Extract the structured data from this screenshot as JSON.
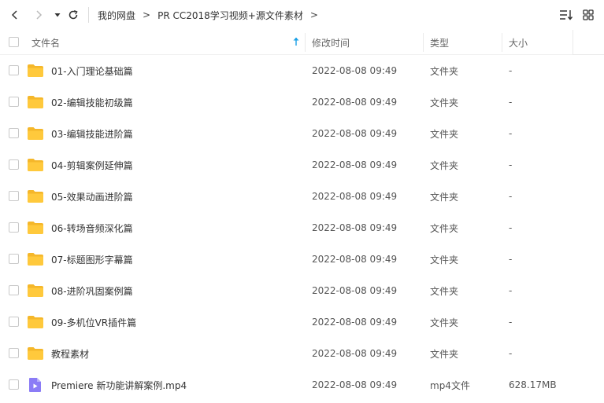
{
  "breadcrumb": [
    {
      "label": "我的网盘"
    },
    {
      "label": "PR CC2018学习视频+源文件素材"
    }
  ],
  "breadcrumb_sep": ">",
  "columns": {
    "name": "文件名",
    "modified": "修改时间",
    "type": "类型",
    "size": "大小"
  },
  "files": [
    {
      "name": "01-入门理论基础篇",
      "modified": "2022-08-08 09:49",
      "type": "文件夹",
      "size": "-",
      "icon": "folder-icon"
    },
    {
      "name": "02-编辑技能初级篇",
      "modified": "2022-08-08 09:49",
      "type": "文件夹",
      "size": "-",
      "icon": "folder-icon"
    },
    {
      "name": "03-编辑技能进阶篇",
      "modified": "2022-08-08 09:49",
      "type": "文件夹",
      "size": "-",
      "icon": "folder-icon"
    },
    {
      "name": "04-剪辑案例延伸篇",
      "modified": "2022-08-08 09:49",
      "type": "文件夹",
      "size": "-",
      "icon": "folder-icon"
    },
    {
      "name": "05-效果动画进阶篇",
      "modified": "2022-08-08 09:49",
      "type": "文件夹",
      "size": "-",
      "icon": "folder-icon"
    },
    {
      "name": "06-转场音频深化篇",
      "modified": "2022-08-08 09:49",
      "type": "文件夹",
      "size": "-",
      "icon": "folder-icon"
    },
    {
      "name": "07-标题图形字幕篇",
      "modified": "2022-08-08 09:49",
      "type": "文件夹",
      "size": "-",
      "icon": "folder-icon"
    },
    {
      "name": "08-进阶巩固案例篇",
      "modified": "2022-08-08 09:49",
      "type": "文件夹",
      "size": "-",
      "icon": "folder-icon"
    },
    {
      "name": "09-多机位VR插件篇",
      "modified": "2022-08-08 09:49",
      "type": "文件夹",
      "size": "-",
      "icon": "folder-icon"
    },
    {
      "name": "教程素材",
      "modified": "2022-08-08 09:49",
      "type": "文件夹",
      "size": "-",
      "icon": "folder-icon"
    },
    {
      "name": "Premiere  新功能讲解案例.mp4",
      "modified": "2022-08-08 09:49",
      "type": "mp4文件",
      "size": "628.17MB",
      "icon": "video-file-icon"
    }
  ],
  "colors": {
    "folder": "#ffc93c",
    "folder_tab": "#f5b72a",
    "video_file": "#8b7cf6",
    "sort_arrow": "#1aa0e6"
  }
}
